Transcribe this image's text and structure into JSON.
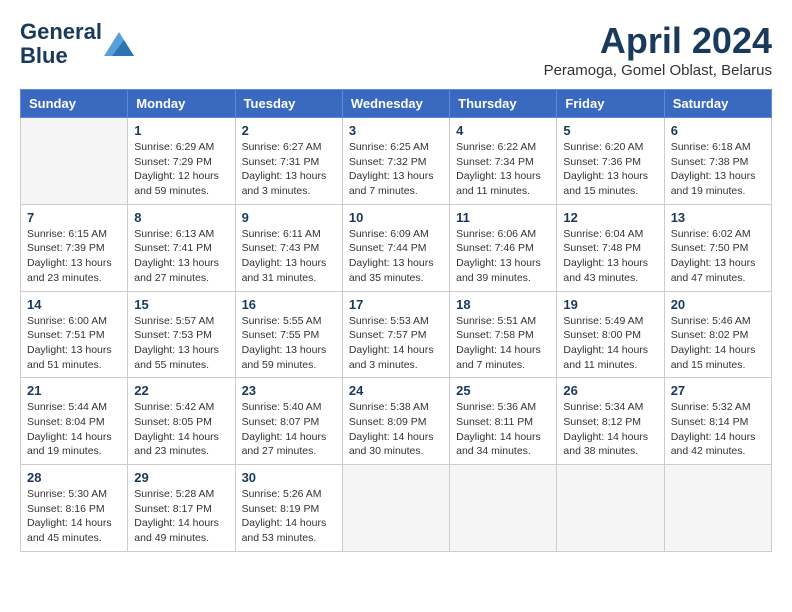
{
  "logo": {
    "line1": "General",
    "line2": "Blue"
  },
  "title": "April 2024",
  "location": "Peramoga, Gomel Oblast, Belarus",
  "days_of_week": [
    "Sunday",
    "Monday",
    "Tuesday",
    "Wednesday",
    "Thursday",
    "Friday",
    "Saturday"
  ],
  "weeks": [
    [
      {
        "num": "",
        "info": ""
      },
      {
        "num": "1",
        "info": "Sunrise: 6:29 AM\nSunset: 7:29 PM\nDaylight: 12 hours\nand 59 minutes."
      },
      {
        "num": "2",
        "info": "Sunrise: 6:27 AM\nSunset: 7:31 PM\nDaylight: 13 hours\nand 3 minutes."
      },
      {
        "num": "3",
        "info": "Sunrise: 6:25 AM\nSunset: 7:32 PM\nDaylight: 13 hours\nand 7 minutes."
      },
      {
        "num": "4",
        "info": "Sunrise: 6:22 AM\nSunset: 7:34 PM\nDaylight: 13 hours\nand 11 minutes."
      },
      {
        "num": "5",
        "info": "Sunrise: 6:20 AM\nSunset: 7:36 PM\nDaylight: 13 hours\nand 15 minutes."
      },
      {
        "num": "6",
        "info": "Sunrise: 6:18 AM\nSunset: 7:38 PM\nDaylight: 13 hours\nand 19 minutes."
      }
    ],
    [
      {
        "num": "7",
        "info": "Sunrise: 6:15 AM\nSunset: 7:39 PM\nDaylight: 13 hours\nand 23 minutes."
      },
      {
        "num": "8",
        "info": "Sunrise: 6:13 AM\nSunset: 7:41 PM\nDaylight: 13 hours\nand 27 minutes."
      },
      {
        "num": "9",
        "info": "Sunrise: 6:11 AM\nSunset: 7:43 PM\nDaylight: 13 hours\nand 31 minutes."
      },
      {
        "num": "10",
        "info": "Sunrise: 6:09 AM\nSunset: 7:44 PM\nDaylight: 13 hours\nand 35 minutes."
      },
      {
        "num": "11",
        "info": "Sunrise: 6:06 AM\nSunset: 7:46 PM\nDaylight: 13 hours\nand 39 minutes."
      },
      {
        "num": "12",
        "info": "Sunrise: 6:04 AM\nSunset: 7:48 PM\nDaylight: 13 hours\nand 43 minutes."
      },
      {
        "num": "13",
        "info": "Sunrise: 6:02 AM\nSunset: 7:50 PM\nDaylight: 13 hours\nand 47 minutes."
      }
    ],
    [
      {
        "num": "14",
        "info": "Sunrise: 6:00 AM\nSunset: 7:51 PM\nDaylight: 13 hours\nand 51 minutes."
      },
      {
        "num": "15",
        "info": "Sunrise: 5:57 AM\nSunset: 7:53 PM\nDaylight: 13 hours\nand 55 minutes."
      },
      {
        "num": "16",
        "info": "Sunrise: 5:55 AM\nSunset: 7:55 PM\nDaylight: 13 hours\nand 59 minutes."
      },
      {
        "num": "17",
        "info": "Sunrise: 5:53 AM\nSunset: 7:57 PM\nDaylight: 14 hours\nand 3 minutes."
      },
      {
        "num": "18",
        "info": "Sunrise: 5:51 AM\nSunset: 7:58 PM\nDaylight: 14 hours\nand 7 minutes."
      },
      {
        "num": "19",
        "info": "Sunrise: 5:49 AM\nSunset: 8:00 PM\nDaylight: 14 hours\nand 11 minutes."
      },
      {
        "num": "20",
        "info": "Sunrise: 5:46 AM\nSunset: 8:02 PM\nDaylight: 14 hours\nand 15 minutes."
      }
    ],
    [
      {
        "num": "21",
        "info": "Sunrise: 5:44 AM\nSunset: 8:04 PM\nDaylight: 14 hours\nand 19 minutes."
      },
      {
        "num": "22",
        "info": "Sunrise: 5:42 AM\nSunset: 8:05 PM\nDaylight: 14 hours\nand 23 minutes."
      },
      {
        "num": "23",
        "info": "Sunrise: 5:40 AM\nSunset: 8:07 PM\nDaylight: 14 hours\nand 27 minutes."
      },
      {
        "num": "24",
        "info": "Sunrise: 5:38 AM\nSunset: 8:09 PM\nDaylight: 14 hours\nand 30 minutes."
      },
      {
        "num": "25",
        "info": "Sunrise: 5:36 AM\nSunset: 8:11 PM\nDaylight: 14 hours\nand 34 minutes."
      },
      {
        "num": "26",
        "info": "Sunrise: 5:34 AM\nSunset: 8:12 PM\nDaylight: 14 hours\nand 38 minutes."
      },
      {
        "num": "27",
        "info": "Sunrise: 5:32 AM\nSunset: 8:14 PM\nDaylight: 14 hours\nand 42 minutes."
      }
    ],
    [
      {
        "num": "28",
        "info": "Sunrise: 5:30 AM\nSunset: 8:16 PM\nDaylight: 14 hours\nand 45 minutes."
      },
      {
        "num": "29",
        "info": "Sunrise: 5:28 AM\nSunset: 8:17 PM\nDaylight: 14 hours\nand 49 minutes."
      },
      {
        "num": "30",
        "info": "Sunrise: 5:26 AM\nSunset: 8:19 PM\nDaylight: 14 hours\nand 53 minutes."
      },
      {
        "num": "",
        "info": ""
      },
      {
        "num": "",
        "info": ""
      },
      {
        "num": "",
        "info": ""
      },
      {
        "num": "",
        "info": ""
      }
    ]
  ]
}
